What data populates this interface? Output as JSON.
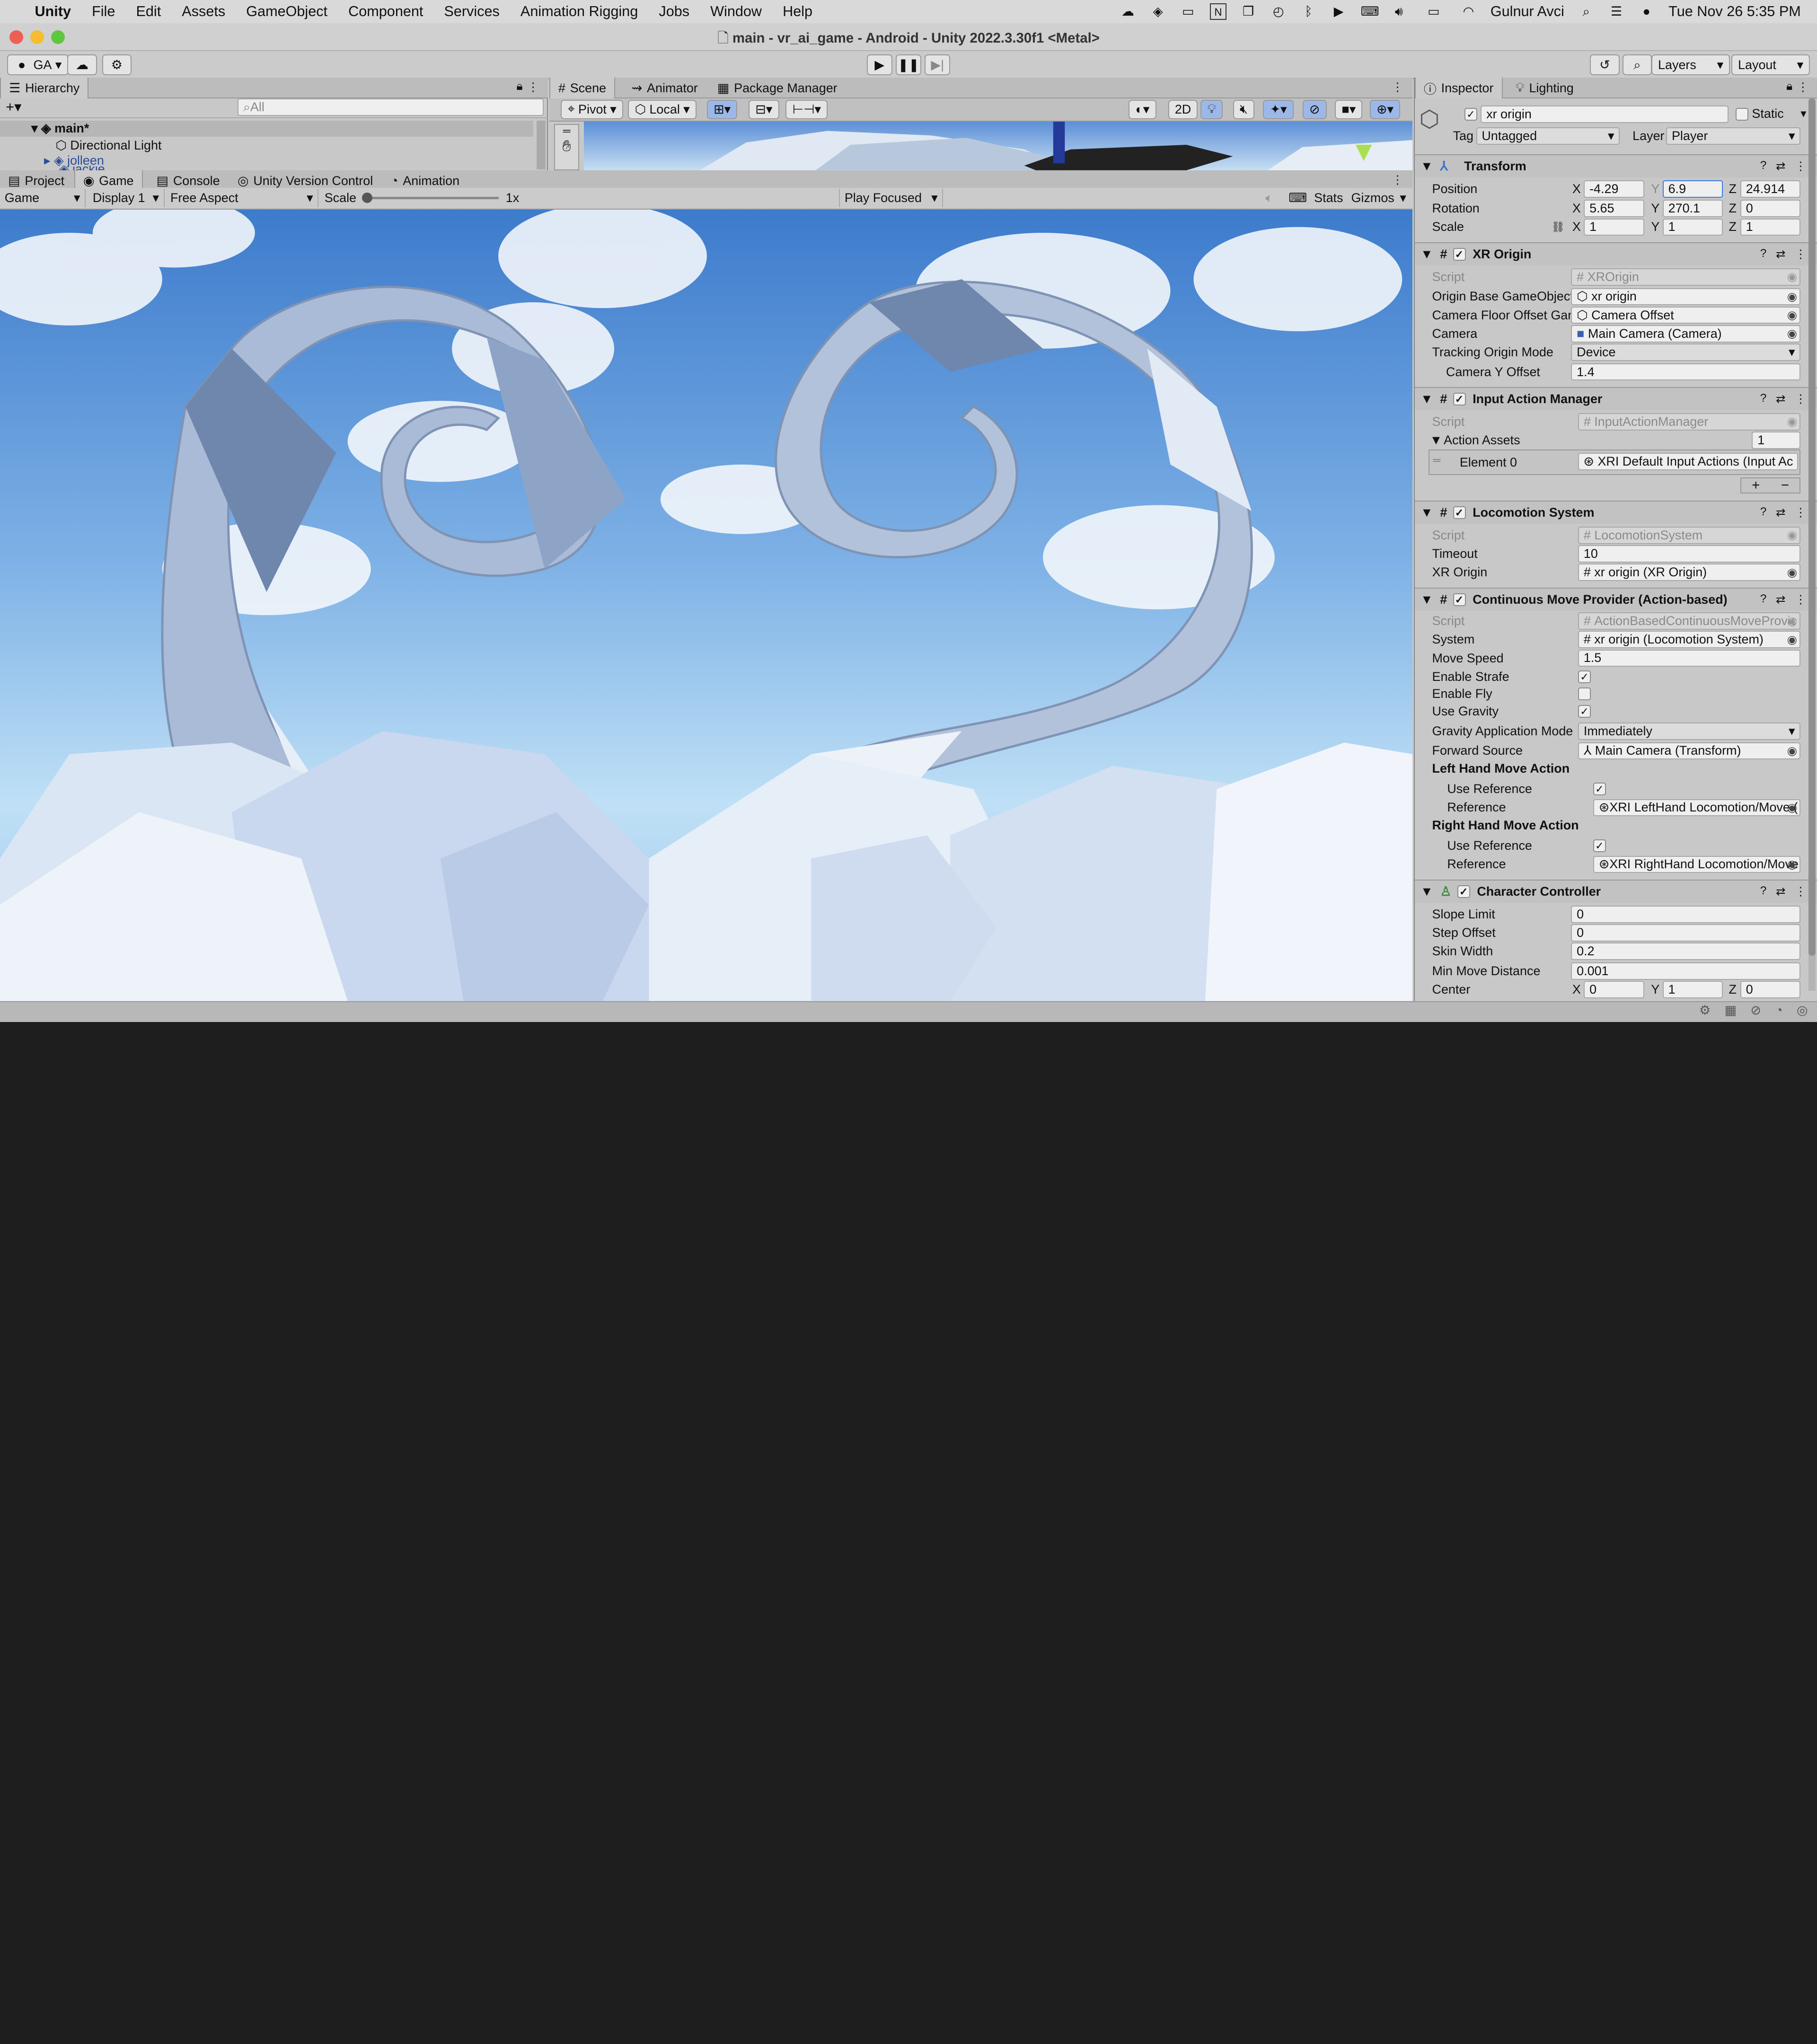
{
  "menubar": {
    "app_name": "Unity",
    "items": [
      "File",
      "Edit",
      "Assets",
      "GameObject",
      "Component",
      "Services",
      "Animation Rigging",
      "Jobs",
      "Window",
      "Help"
    ],
    "user": "Gulnur Avci",
    "datetime": "Tue Nov 26  5:35 PM"
  },
  "window": {
    "title": "main - vr_ai_game - Android - Unity 2022.3.30f1 <Metal>"
  },
  "toolbar": {
    "account": "GA",
    "layers": "Layers",
    "layout": "Layout"
  },
  "hierarchy": {
    "tab": "Hierarchy",
    "search_placeholder": "All",
    "scene": "main*",
    "items": [
      "Directional Light",
      "jolleen",
      "jackie"
    ]
  },
  "scene_tabs": [
    "Scene",
    "Animator",
    "Package Manager"
  ],
  "scene_toolbar": {
    "pivot": "Pivot",
    "local": "Local",
    "mode2d": "2D"
  },
  "bottom_tabs": [
    "Project",
    "Game",
    "Console",
    "Unity Version Control",
    "Animation"
  ],
  "game_toolbar": {
    "view": "Game",
    "display": "Display 1",
    "aspect": "Free Aspect",
    "scale_label": "Scale",
    "scale_value": "1x",
    "play_mode": "Play Focused",
    "stats": "Stats",
    "gizmos": "Gizmos"
  },
  "inspector": {
    "tabs": [
      "Inspector",
      "Lighting"
    ],
    "object_name": "xr origin",
    "static_label": "Static",
    "tag_label": "Tag",
    "tag": "Untagged",
    "layer_label": "Layer",
    "layer": "Player",
    "transform": {
      "title": "Transform",
      "position_label": "Position",
      "position": [
        "-4.29",
        "6.9",
        "24.914"
      ],
      "rotation_label": "Rotation",
      "rotation": [
        "5.65",
        "270.1",
        "0"
      ],
      "scale_label": "Scale",
      "scale": [
        "1",
        "1",
        "1"
      ]
    },
    "xr_origin": {
      "title": "XR Origin",
      "script_label": "Script",
      "script": "XROrigin",
      "origin_base_label": "Origin Base GameObject",
      "origin_base": "xr origin",
      "camera_floor_label": "Camera Floor Offset Game",
      "camera_floor": "Camera Offset",
      "camera_label": "Camera",
      "camera": "Main Camera (Camera)",
      "tracking_label": "Tracking Origin Mode",
      "tracking": "Device",
      "camera_y_label": "Camera Y Offset",
      "camera_y": "1.4"
    },
    "input_action_manager": {
      "title": "Input Action Manager",
      "script_label": "Script",
      "script": "InputActionManager",
      "assets_label": "Action Assets",
      "assets_count": "1",
      "element_label": "Element 0",
      "element": "XRI Default Input Actions (Input Ac"
    },
    "locomotion_system": {
      "title": "Locomotion System",
      "script_label": "Script",
      "script": "LocomotionSystem",
      "timeout_label": "Timeout",
      "timeout": "10",
      "xr_origin_label": "XR Origin",
      "xr_origin": "xr origin (XR Origin)"
    },
    "continuous_move": {
      "title": "Continuous Move Provider (Action-based)",
      "script_label": "Script",
      "script": "ActionBasedContinuousMoveProvic",
      "system_label": "System",
      "system": "xr origin (Locomotion System)",
      "move_speed_label": "Move Speed",
      "move_speed": "1.5",
      "strafe_label": "Enable Strafe",
      "strafe": true,
      "fly_label": "Enable Fly",
      "fly": false,
      "gravity_label": "Use Gravity",
      "gravity": true,
      "gravity_mode_label": "Gravity Application Mode",
      "gravity_mode": "Immediately",
      "forward_label": "Forward Source",
      "forward": "Main Camera (Transform)",
      "left_section": "Left Hand Move Action",
      "right_section": "Right Hand Move Action",
      "use_ref_label": "Use Reference",
      "ref_label": "Reference",
      "left_ref": "XRI LeftHand Locomotion/Move (",
      "right_ref": "XRI RightHand Locomotion/Move"
    },
    "character_controller": {
      "title": "Character Controller",
      "slope_label": "Slope Limit",
      "slope": "0",
      "step_label": "Step Offset",
      "step": "0",
      "skin_label": "Skin Width",
      "skin": "0.2",
      "min_move_label": "Min Move Distance",
      "min_move": "0.001",
      "center_label": "Center",
      "center": [
        "0",
        "1",
        "0"
      ]
    }
  },
  "colors": {
    "sky_top": "#3f7fd0",
    "sky_bottom": "#bfe0f6",
    "rock": "#9fb3cf",
    "accent": "#3d7be0"
  }
}
